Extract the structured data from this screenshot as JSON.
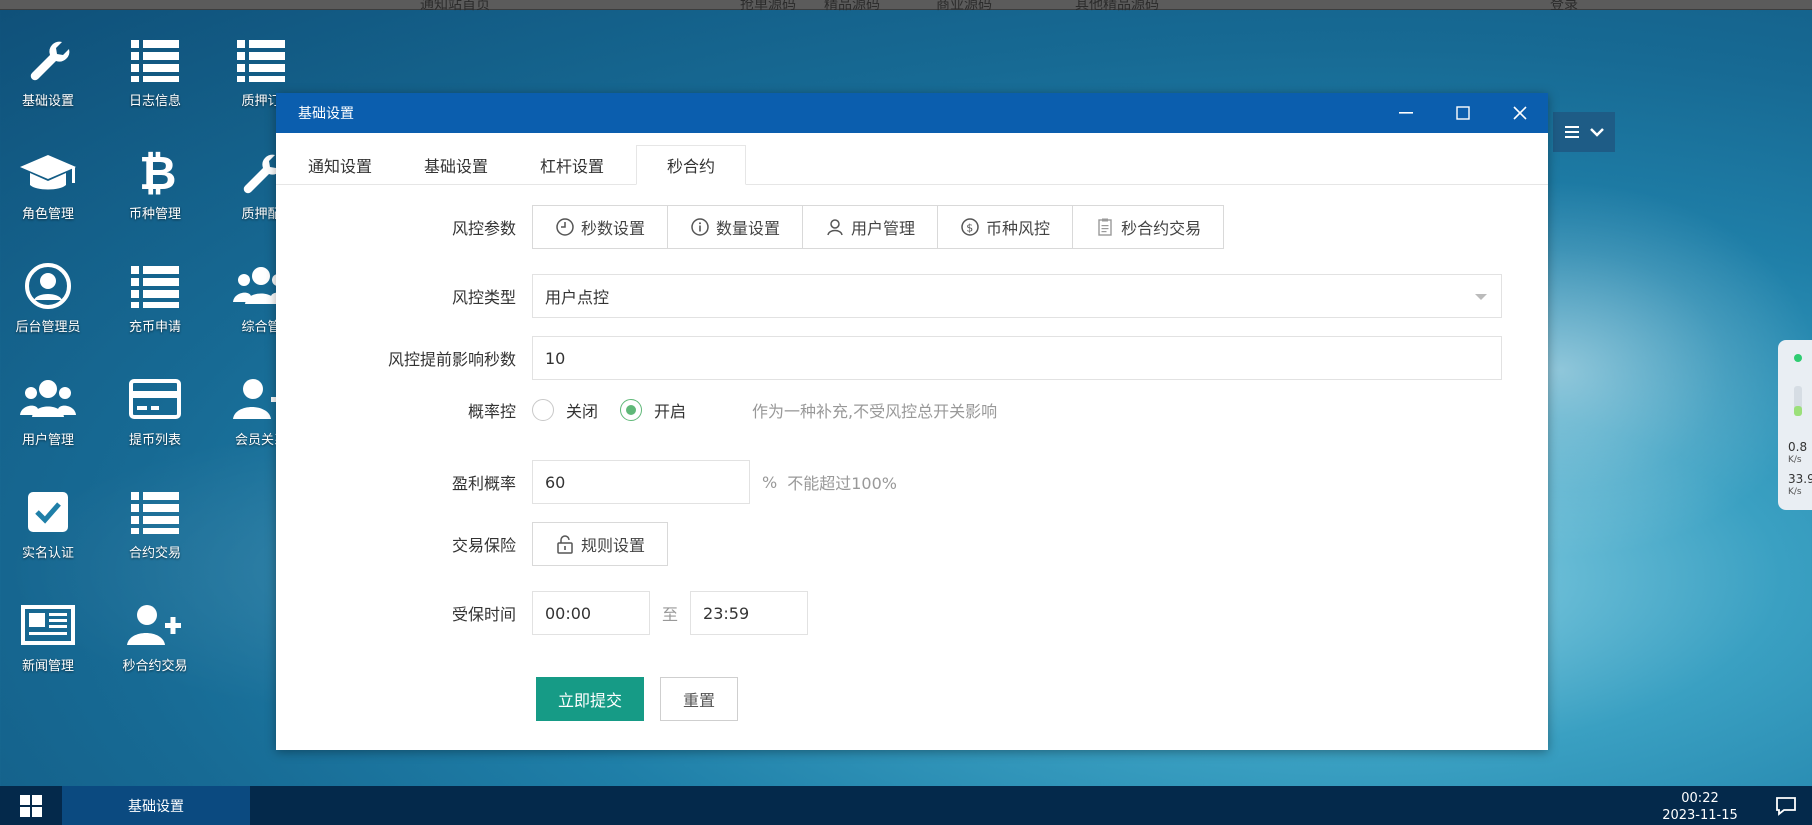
{
  "topbar": {
    "fragments": [
      "通知站",
      "首页",
      "抢单源码",
      "精品源码",
      "商业源码",
      "其他精品源码",
      "登录"
    ]
  },
  "desktop_icons": [
    {
      "label": "基础设置",
      "icon": "wrench-icon"
    },
    {
      "label": "日志信息",
      "icon": "list-icon"
    },
    {
      "label": "质押订",
      "icon": "list-icon"
    },
    {
      "label": "角色管理",
      "icon": "graduation-cap-icon"
    },
    {
      "label": "币种管理",
      "icon": "bitcoin-icon"
    },
    {
      "label": "质押配",
      "icon": "wrench-icon"
    },
    {
      "label": "后台管理员",
      "icon": "user-circle-icon"
    },
    {
      "label": "充币申请",
      "icon": "list-icon"
    },
    {
      "label": "综合管",
      "icon": "users-icon"
    },
    {
      "label": "用户管理",
      "icon": "users-icon"
    },
    {
      "label": "提币列表",
      "icon": "credit-card-icon"
    },
    {
      "label": "会员关系",
      "icon": "user-add-icon"
    },
    {
      "label": "实名认证",
      "icon": "check-square-icon"
    },
    {
      "label": "合约交易",
      "icon": "list-icon"
    },
    {
      "label": "新闻管理",
      "icon": "newspaper-icon"
    },
    {
      "label": "秒合约交易",
      "icon": "user-add-icon"
    }
  ],
  "window": {
    "title": "基础设置",
    "tabs": [
      {
        "label": "通知设置"
      },
      {
        "label": "基础设置"
      },
      {
        "label": "杠杆设置"
      },
      {
        "label": "秒合约",
        "active": true
      }
    ],
    "form": {
      "risk_params": {
        "label": "风控参数",
        "buttons": [
          {
            "label": "秒数设置",
            "icon": "clock-icon"
          },
          {
            "label": "数量设置",
            "icon": "info-icon"
          },
          {
            "label": "用户管理",
            "icon": "user-icon"
          },
          {
            "label": "币种风控",
            "icon": "dollar-icon"
          },
          {
            "label": "秒合约交易",
            "icon": "clipboard-icon"
          }
        ]
      },
      "risk_type": {
        "label": "风控类型",
        "value": "用户点控"
      },
      "risk_seconds": {
        "label": "风控提前影响秒数",
        "value": "10"
      },
      "probability": {
        "label": "概率控",
        "options": [
          "关闭",
          "开启"
        ],
        "selected": "开启",
        "hint": "作为一种补充,不受风控总开关影响"
      },
      "profit_rate": {
        "label": "盈利概率",
        "value": "60",
        "unit": "%",
        "hint": "不能超过100%"
      },
      "insurance": {
        "label": "交易保险",
        "button": "规则设置"
      },
      "insured_time": {
        "label": "受保时间",
        "start": "00:00",
        "sep": "至",
        "end": "23:59"
      },
      "submit": "立即提交",
      "reset": "重置"
    }
  },
  "side_widget": {
    "upload": "0.8",
    "upload_unit": "K/s",
    "download": "33.9",
    "download_unit": "K/s"
  },
  "taskbar": {
    "active_item": "基础设置",
    "time": "00:22",
    "date": "2023-11-15"
  },
  "colors": {
    "titlebar": "#0b5eae",
    "primary": "#169b86",
    "radio_on": "#5fb878",
    "taskbar": "#04294b"
  }
}
